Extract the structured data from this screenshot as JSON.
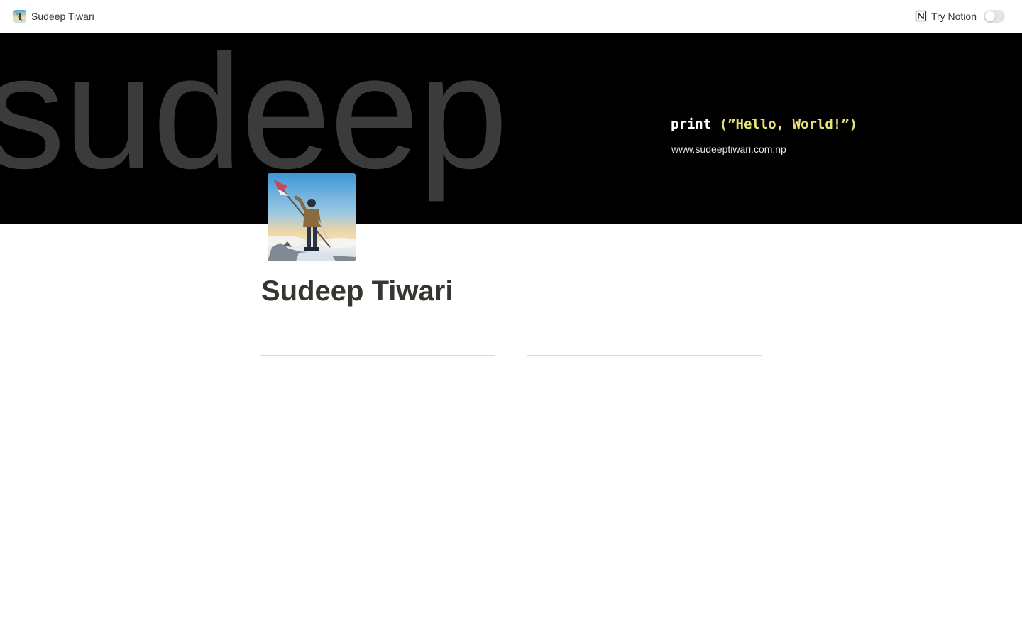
{
  "topbar": {
    "breadcrumb_label": "Sudeep Tiwari",
    "breadcrumb_icon": "profile-thumbnail-icon",
    "try_notion_label": "Try Notion",
    "notion_icon": "notion-logo-icon",
    "theme_toggle_on": false
  },
  "cover": {
    "background_color": "#000000",
    "large_word": "sudeep",
    "code_print": "print",
    "code_string": "(”Hello, World!”)",
    "url": "www.sudeeptiwari.com.np"
  },
  "page": {
    "icon": "mountaineer-with-flag-photo",
    "title": "Sudeep Tiwari"
  },
  "colors": {
    "text": "#37352f",
    "code_string": "#e6e37a",
    "divider": "#dcdcda"
  }
}
